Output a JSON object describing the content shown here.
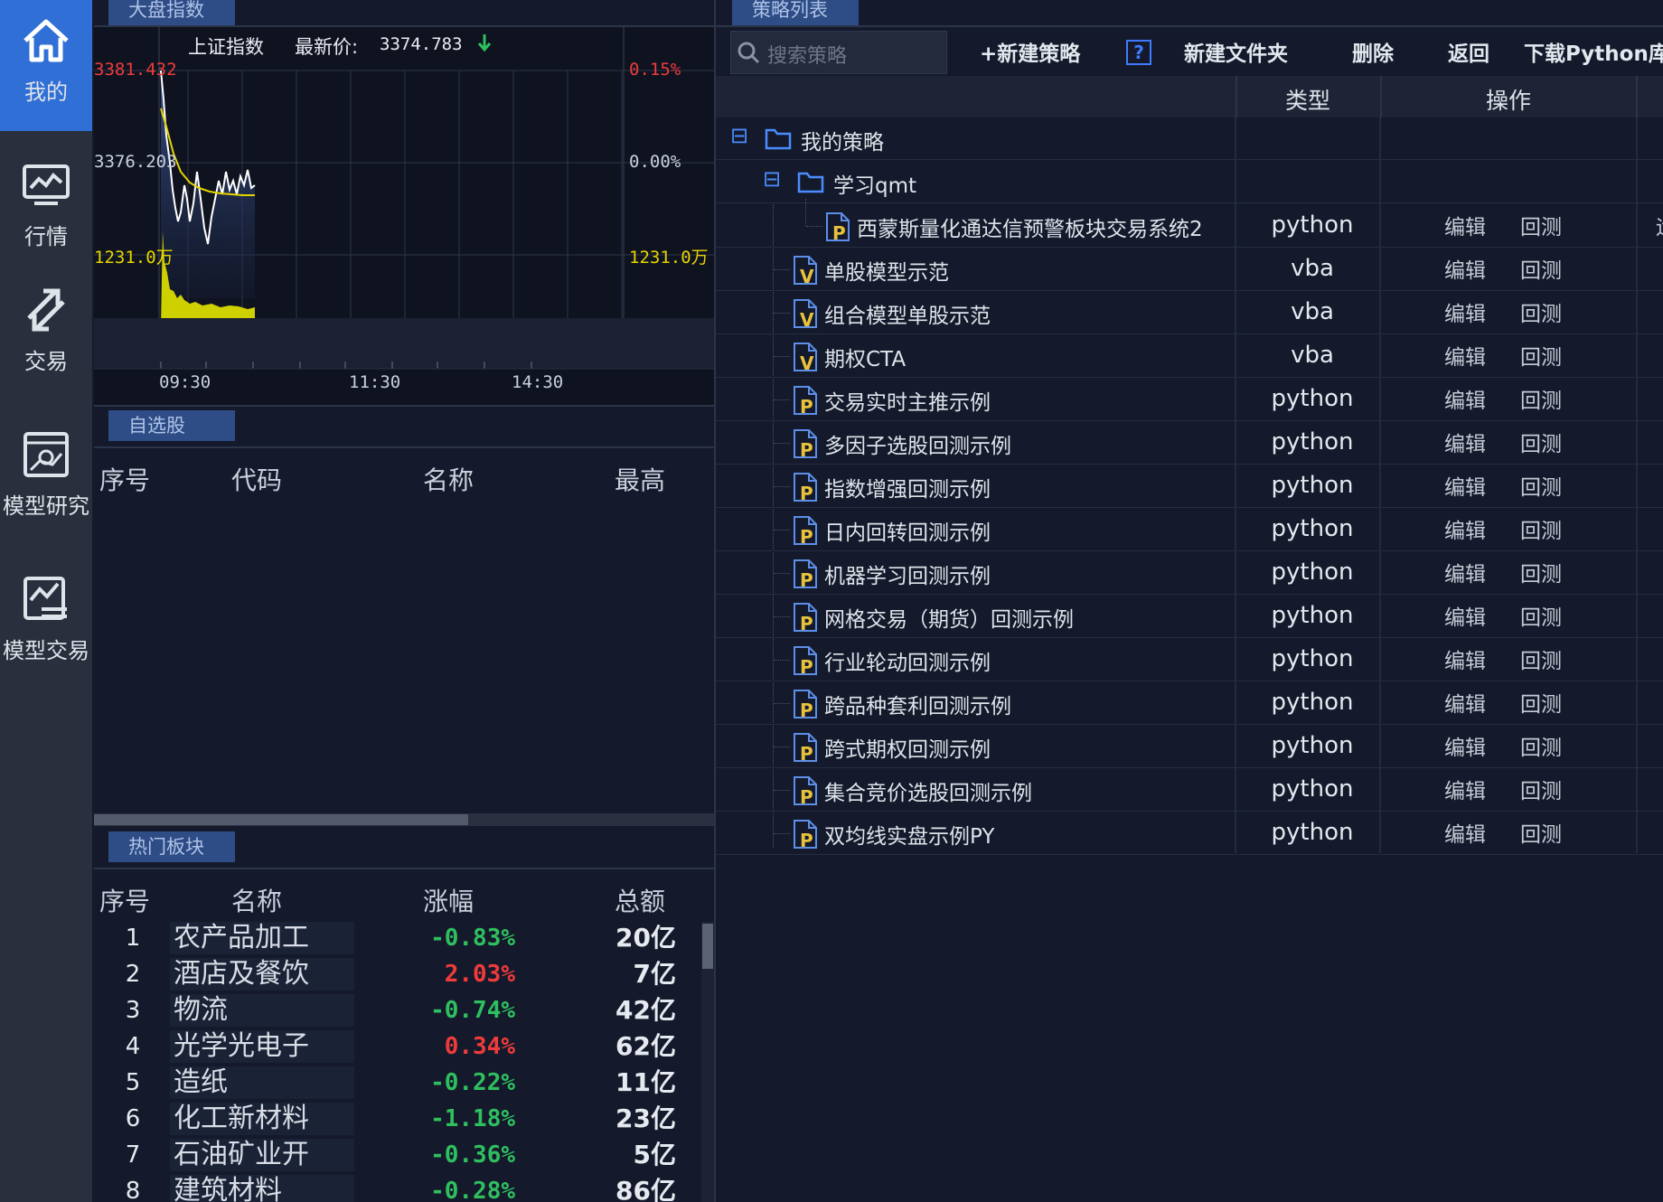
{
  "nav": [
    {
      "label": "我的",
      "icon": "home-icon",
      "active": true
    },
    {
      "label": "行情",
      "icon": "chart-monitor-icon"
    },
    {
      "label": "交易",
      "icon": "exchange-arrows-icon"
    },
    {
      "label": "模型研究",
      "icon": "model-research-icon"
    },
    {
      "label": "模型交易",
      "icon": "model-trade-icon"
    }
  ],
  "index_panel": {
    "tab": "大盘指数",
    "index_name": "上证指数",
    "latest_label": "最新价:",
    "latest_price": "3374.783",
    "price_high": "3381.432",
    "price_mid": "3376.203",
    "pct_high": "0.15%",
    "pct_mid": "0.00%",
    "vol_left": "1231.0万",
    "vol_right": "1231.0万",
    "times": [
      "09:30",
      "11:30",
      "14:30"
    ]
  },
  "watchlist": {
    "tab": "自选股",
    "columns": [
      "序号",
      "代码",
      "名称",
      "最高"
    ]
  },
  "hot_sectors": {
    "tab": "热门板块",
    "columns": [
      "序号",
      "名称",
      "涨幅",
      "总额"
    ],
    "rows": [
      {
        "seq": "1",
        "name": "农产品加工",
        "change": "-0.83%",
        "amount": "20亿"
      },
      {
        "seq": "2",
        "name": "酒店及餐饮",
        "change": "2.03%",
        "amount": "7亿"
      },
      {
        "seq": "3",
        "name": "物流",
        "change": "-0.74%",
        "amount": "42亿"
      },
      {
        "seq": "4",
        "name": "光学光电子",
        "change": "0.34%",
        "amount": "62亿"
      },
      {
        "seq": "5",
        "name": "造纸",
        "change": "-0.22%",
        "amount": "11亿"
      },
      {
        "seq": "6",
        "name": "化工新材料",
        "change": "-1.18%",
        "amount": "23亿"
      },
      {
        "seq": "7",
        "name": "石油矿业开",
        "change": "-0.36%",
        "amount": "5亿"
      },
      {
        "seq": "8",
        "name": "建筑材料",
        "change": "-0.28%",
        "amount": "86亿"
      }
    ]
  },
  "strategy_panel": {
    "tab": "策略列表",
    "search_placeholder": "搜索策略",
    "toolbar": {
      "new_strategy": "+新建策略",
      "help": "?",
      "new_folder": "新建文件夹",
      "delete": "删除",
      "back": "返回",
      "download": "下载Python库"
    },
    "columns": {
      "type": "类型",
      "ops": "操作"
    },
    "folders": [
      {
        "name": "我的策略",
        "toggle": "⊟"
      },
      {
        "name": "学习qmt",
        "toggle": "⊟"
      }
    ],
    "op_edit": "编辑",
    "op_backtest": "回测",
    "cut_off_char": "运",
    "rows": [
      {
        "name": "西蒙斯量化通达信预警板块交易系统2",
        "type": "python",
        "badge": "P",
        "indent": 2
      },
      {
        "name": "单股模型示范",
        "type": "vba",
        "badge": "V",
        "indent": 1
      },
      {
        "name": "组合模型单股示范",
        "type": "vba",
        "badge": "V",
        "indent": 1
      },
      {
        "name": "期权CTA",
        "type": "vba",
        "badge": "V",
        "indent": 1
      },
      {
        "name": "交易实时主推示例",
        "type": "python",
        "badge": "P",
        "indent": 1
      },
      {
        "name": "多因子选股回测示例",
        "type": "python",
        "badge": "P",
        "indent": 1
      },
      {
        "name": "指数增强回测示例",
        "type": "python",
        "badge": "P",
        "indent": 1
      },
      {
        "name": "日内回转回测示例",
        "type": "python",
        "badge": "P",
        "indent": 1
      },
      {
        "name": "机器学习回测示例",
        "type": "python",
        "badge": "P",
        "indent": 1
      },
      {
        "name": "网格交易（期货）回测示例",
        "type": "python",
        "badge": "P",
        "indent": 1
      },
      {
        "name": "行业轮动回测示例",
        "type": "python",
        "badge": "P",
        "indent": 1
      },
      {
        "name": "跨品种套利回测示例",
        "type": "python",
        "badge": "P",
        "indent": 1
      },
      {
        "name": "跨式期权回测示例",
        "type": "python",
        "badge": "P",
        "indent": 1
      },
      {
        "name": "集合竞价选股回测示例",
        "type": "python",
        "badge": "P",
        "indent": 1
      },
      {
        "name": "双均线实盘示例PY",
        "type": "python",
        "badge": "P",
        "indent": 1
      }
    ]
  },
  "colors": {
    "accent": "#2f6fd6",
    "up": "#ef3b3b",
    "down": "#2fbf5f",
    "price_line": "#ffffff",
    "avg_line": "#e6d400",
    "volume": "#cfd000"
  }
}
